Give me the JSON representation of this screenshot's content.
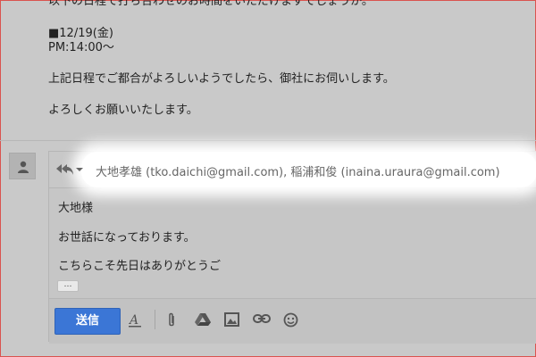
{
  "email_body": {
    "lines": [
      "以下の日程で打ち合わせのお時間をいただけますでしょうか。",
      "■12/19(金)",
      "PM:14:00〜",
      "上記日程でご都合がよろしいようでしたら、御社にお伺いします。",
      "よろしくお願いいたします。"
    ]
  },
  "reply": {
    "recipients": "大地孝雄 (tko.daichi@gmail.com), 稲浦和俊 (inaina.uraura@gmail.com)",
    "body_lines": [
      "大地様",
      "お世話になっております。",
      "こちらこそ先日はありがとうご"
    ],
    "ellipsis": "…",
    "send_label": "送信"
  },
  "toolbar": {
    "icons": [
      "text-format-icon",
      "attach-icon",
      "drive-icon",
      "photo-icon",
      "link-icon",
      "emoji-icon"
    ]
  },
  "colors": {
    "send": "#3b76d6",
    "background": "#c9c9c9",
    "highlight": "#ffffff"
  }
}
